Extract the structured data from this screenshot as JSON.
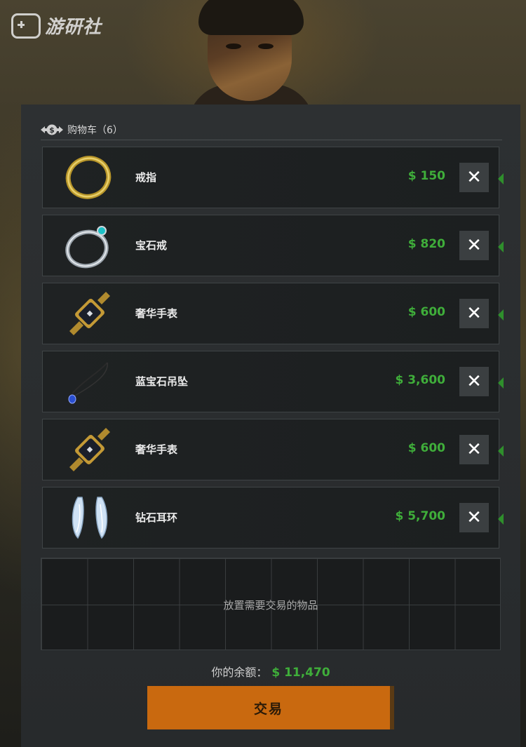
{
  "watermark": {
    "text": "游研社",
    "icon": "game-controller-plus-icon"
  },
  "cart": {
    "icon": "money-exchange-icon",
    "title": "购物车（6）",
    "items": [
      {
        "name": "戒指",
        "price": "$ 150",
        "icon": "gold-ring-icon",
        "remove_label": "✕"
      },
      {
        "name": "宝石戒",
        "price": "$ 820",
        "icon": "gemstone-ring-icon",
        "remove_label": "✕"
      },
      {
        "name": "奢华手表",
        "price": "$ 600",
        "icon": "luxury-watch-icon",
        "remove_label": "✕"
      },
      {
        "name": "蓝宝石吊坠",
        "price": "$ 3,600",
        "icon": "sapphire-pendant-icon",
        "remove_label": "✕"
      },
      {
        "name": "奢华手表",
        "price": "$ 600",
        "icon": "luxury-watch-icon",
        "remove_label": "✕"
      },
      {
        "name": "钻石耳环",
        "price": "$ 5,700",
        "icon": "diamond-earrings-icon",
        "remove_label": "✕"
      }
    ]
  },
  "drop_area": {
    "placeholder": "放置需要交易的物品"
  },
  "balance": {
    "label": "你的余额：",
    "value": "$ 11,470"
  },
  "trade": {
    "label": "交易"
  },
  "colors": {
    "price_green": "#3fae3a",
    "trade_orange": "#c9690f",
    "panel_bg": "#2b2e30"
  }
}
